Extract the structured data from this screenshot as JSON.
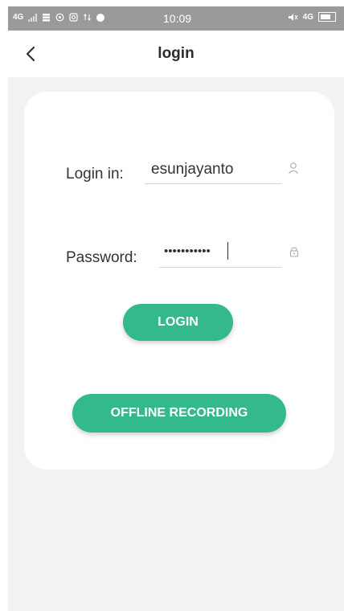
{
  "status_bar": {
    "network_left": "4G",
    "time": "10:09",
    "network_right": "4G",
    "icons": [
      "signal-icon",
      "storage-icon",
      "whatsapp-icon",
      "instagram-icon",
      "data-transfer-icon",
      "notification-dot-icon",
      "mute-icon",
      "battery-icon"
    ]
  },
  "header": {
    "title": "login",
    "back_icon": "chevron-left-icon"
  },
  "form": {
    "login_label": "Login in:",
    "login_value": "esunjayanto",
    "login_icon": "user-icon",
    "password_label": "Password:",
    "password_value": "•••••••••••",
    "password_icon": "lock-icon",
    "login_button": "LOGIN",
    "offline_button": "OFFLINE RECORDING"
  },
  "colors": {
    "accent": "#33b98a",
    "background": "#f2f2f2",
    "status_bar": "#9a9a9a",
    "card": "#ffffff"
  }
}
